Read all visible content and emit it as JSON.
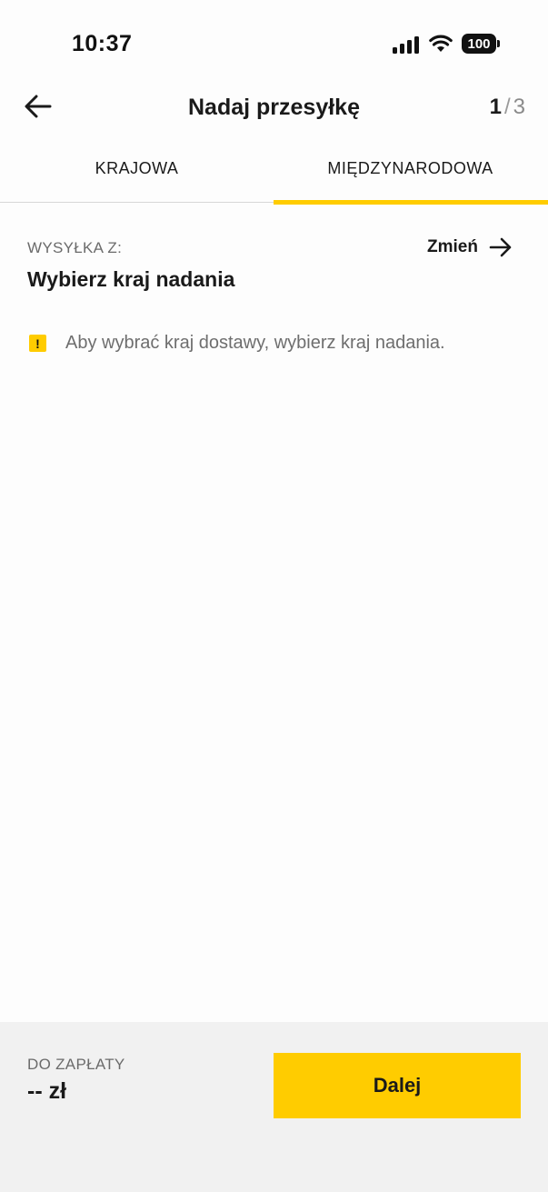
{
  "status_bar": {
    "time": "10:37",
    "battery": "100",
    "icons": [
      "signal-icon",
      "wifi-icon",
      "battery-icon"
    ]
  },
  "header": {
    "title": "Nadaj przesyłkę",
    "step_current": "1",
    "step_separator": "/",
    "step_total": "3",
    "back_icon": "arrow-left-icon"
  },
  "tabs": [
    {
      "label": "KRAJOWA",
      "active": false
    },
    {
      "label": "MIĘDZYNARODOWA",
      "active": true
    }
  ],
  "origin": {
    "label": "WYSYŁKA Z:",
    "value": "Wybierz kraj nadania",
    "change_label": "Zmień",
    "change_icon": "arrow-right-icon"
  },
  "warning": {
    "icon": "warning-icon",
    "icon_glyph": "!",
    "text": "Aby wybrać kraj dostawy, wybierz kraj nadania."
  },
  "footer": {
    "pay_label": "DO ZAPŁATY",
    "pay_amount": "-- zł",
    "next_label": "Dalej"
  },
  "colors": {
    "accent": "#ffcc00",
    "text": "#1a1a1a",
    "muted": "#6b6b6b",
    "footer_bg": "#f1f1f1"
  }
}
